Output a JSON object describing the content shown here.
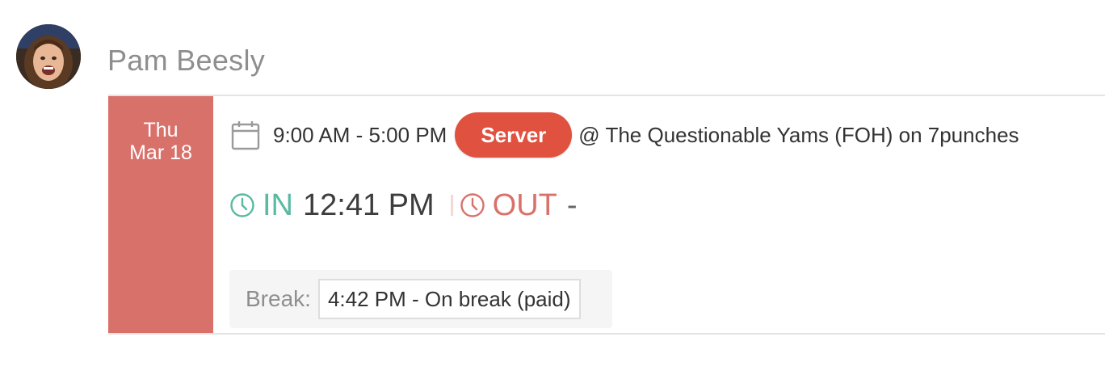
{
  "employee": {
    "name": "Pam Beesly",
    "avatar_icon": "employee-photo"
  },
  "shift": {
    "day_of_week": "Thu",
    "date": "Mar 18",
    "calendar_icon": "calendar-icon",
    "time_range": "9:00 AM - 5:00 PM",
    "role": "Server",
    "location": "@ The Questionable Yams (FOH) on 7punches",
    "colors": {
      "date_block": "#d9716b",
      "role_badge": "#e05140"
    }
  },
  "punch": {
    "in_label": "IN",
    "in_time": "12:41 PM",
    "out_label": "OUT",
    "out_time": "-",
    "clock_icon": "clock-icon",
    "colors": {
      "in": "#5ab9a2",
      "out": "#d9716b"
    }
  },
  "break": {
    "label": "Break:",
    "entry": "4:42 PM - On break (paid)"
  }
}
